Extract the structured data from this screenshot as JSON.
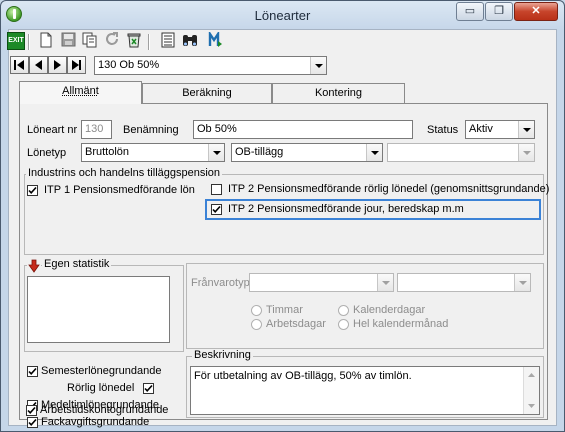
{
  "window": {
    "title": "Lönearter",
    "minimize_glyph": "▭",
    "restore_glyph": "❐",
    "close_glyph": "✕"
  },
  "toolbar": {
    "exit_label": "EXIT",
    "icons": [
      "exit-icon",
      "new-document-icon",
      "save-icon",
      "copy-icon",
      "refresh-icon",
      "delete-icon",
      "list-icon",
      "binoculars-icon",
      "m-arrow-icon"
    ]
  },
  "navigator": {
    "selected": "130 Ob 50%"
  },
  "tabs": [
    {
      "label": "Allmänt"
    },
    {
      "label": "Beräkning"
    },
    {
      "label": "Kontering"
    }
  ],
  "general": {
    "loneart_nr_label": "Löneart nr",
    "loneart_nr_value": "130",
    "benamning_label": "Benämning",
    "benamning_value": "Ob 50%",
    "status_label": "Status",
    "status_value": "Aktiv",
    "lonetyp_label": "Lönetyp",
    "lonetyp_value": "Bruttolön",
    "category_value": "OB-tillägg",
    "extra_value": ""
  },
  "pension": {
    "title": "Industrins och handelns tilläggspension",
    "itp1_label": "ITP 1 Pensionsmedförande lön",
    "itp1_checked": true,
    "itp2_rorlig_label": "ITP 2 Pensionsmedförande rörlig lönedel (genomsnittsgrundande)",
    "itp2_rorlig_checked": false,
    "itp2_jour_label": "ITP 2 Pensionsmedförande jour, beredskap m.m",
    "itp2_jour_checked": true,
    "highlight_color": "#3b82d6"
  },
  "egen_statistik": {
    "title": "Egen statistik"
  },
  "franvaro": {
    "franvarotyp_label": "Frånvarotyp",
    "radio_timmar": "Timmar",
    "radio_arbetsdagar": "Arbetsdagar",
    "radio_kalenderdagar": "Kalenderdagar",
    "radio_hel_kalendermanad": "Hel kalendermånad"
  },
  "grundande": {
    "semester": "Semesterlönegrundande",
    "rorlig": "Rörlig lönedel",
    "medeltim": "Medeltimlönegrundande",
    "fackavgift": "Fackavgiftsgrundande",
    "arbetstid": "Arbetstidskontogrundande"
  },
  "beskrivning": {
    "title": "Beskrivning",
    "text": "För utbetalning av OB-tillägg, 50% av timlön."
  }
}
